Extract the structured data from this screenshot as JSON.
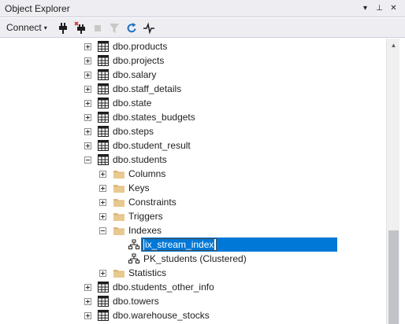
{
  "window": {
    "title": "Object Explorer",
    "buttons": {
      "dropdown": "▾",
      "pin": "⊥",
      "close": "✕"
    }
  },
  "toolbar": {
    "connect_label": "Connect",
    "connect_caret": "▾",
    "icons": [
      "connect-plug-icon",
      "disconnect-plug-icon",
      "stop-icon",
      "filter-icon",
      "refresh-icon",
      "activity-monitor-icon"
    ]
  },
  "tree": {
    "items": [
      {
        "label": "dbo.products",
        "icon": "table-icon",
        "expander": "plus",
        "level": 1
      },
      {
        "label": "dbo.projects",
        "icon": "table-icon",
        "expander": "plus",
        "level": 1
      },
      {
        "label": "dbo.salary",
        "icon": "table-icon",
        "expander": "plus",
        "level": 1
      },
      {
        "label": "dbo.staff_details",
        "icon": "table-icon",
        "expander": "plus",
        "level": 1
      },
      {
        "label": "dbo.state",
        "icon": "table-icon",
        "expander": "plus",
        "level": 1
      },
      {
        "label": "dbo.states_budgets",
        "icon": "table-icon",
        "expander": "plus",
        "level": 1
      },
      {
        "label": "dbo.steps",
        "icon": "table-icon",
        "expander": "plus",
        "level": 1
      },
      {
        "label": "dbo.student_result",
        "icon": "table-icon",
        "expander": "plus",
        "level": 1
      },
      {
        "label": "dbo.students",
        "icon": "table-icon",
        "expander": "minus",
        "level": 1
      },
      {
        "label": "Columns",
        "icon": "folder-icon",
        "expander": "plus",
        "level": 2
      },
      {
        "label": "Keys",
        "icon": "folder-icon",
        "expander": "plus",
        "level": 2
      },
      {
        "label": "Constraints",
        "icon": "folder-icon",
        "expander": "plus",
        "level": 2
      },
      {
        "label": "Triggers",
        "icon": "folder-icon",
        "expander": "plus",
        "level": 2
      },
      {
        "label": "Indexes",
        "icon": "folder-icon",
        "expander": "minus",
        "level": 2
      },
      {
        "label": "ix_stream_index",
        "icon": "index-icon",
        "expander": "none",
        "level": 3,
        "editing": true
      },
      {
        "label": "PK_students (Clustered)",
        "icon": "index-icon",
        "expander": "none",
        "level": 3
      },
      {
        "label": "Statistics",
        "icon": "folder-icon",
        "expander": "plus",
        "level": 2
      },
      {
        "label": "dbo.students_other_info",
        "icon": "table-icon",
        "expander": "plus",
        "level": 1
      },
      {
        "label": "dbo.towers",
        "icon": "table-icon",
        "expander": "plus",
        "level": 1
      },
      {
        "label": "dbo.warehouse_stocks",
        "icon": "table-icon",
        "expander": "plus",
        "level": 1
      }
    ]
  },
  "scrollbar": {
    "up_arrow": "▲",
    "position": 0.97
  },
  "colors": {
    "selection": "#0078d7",
    "folder": "#dcb67a",
    "chrome": "#eeeef2",
    "refresh": "#1f6fbf"
  }
}
